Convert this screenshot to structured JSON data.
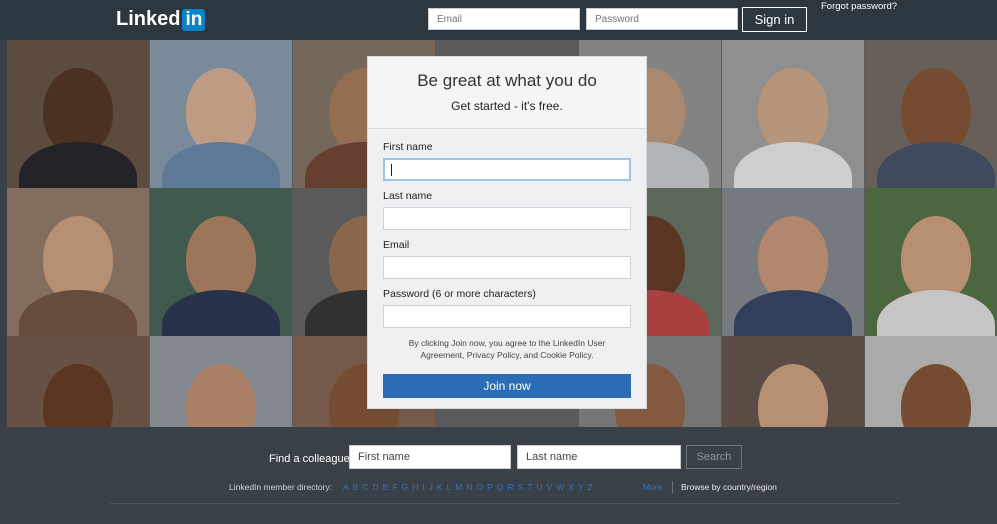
{
  "header": {
    "logo_text": "Linked",
    "logo_in": "in",
    "email_placeholder": "Email",
    "password_placeholder": "Password",
    "sign_in_label": "Sign in",
    "forgot_password": "Forgot password?"
  },
  "signup": {
    "title": "Be great at what you do",
    "subtitle": "Get started - it's free.",
    "fields": [
      {
        "label": "First name",
        "value": ""
      },
      {
        "label": "Last name",
        "value": ""
      },
      {
        "label": "Email",
        "value": ""
      },
      {
        "label": "Password (6 or more characters)",
        "value": ""
      }
    ],
    "terms_text": "By clicking Join now, you agree to the LinkedIn User Agreement, Privacy Policy, and Cookie Policy.",
    "join_label": "Join now"
  },
  "colleague": {
    "label": "Find a colleague",
    "first_name_placeholder": "First name",
    "last_name_placeholder": "Last name",
    "search_label": "Search"
  },
  "directory": {
    "label": "LinkedIn member directory:",
    "letters": [
      "A",
      "B",
      "C",
      "D",
      "E",
      "F",
      "G",
      "H",
      "I",
      "J",
      "K",
      "L",
      "M",
      "N",
      "O",
      "P",
      "Q",
      "R",
      "S",
      "T",
      "U",
      "V",
      "W",
      "X",
      "Y",
      "Z"
    ],
    "more": "More",
    "browse": "Browse by country/region"
  },
  "colors": {
    "topbar": "#2c3740",
    "brand_blue": "#0a84c6",
    "join_button": "#2a6db5",
    "footer": "#3a4047"
  }
}
